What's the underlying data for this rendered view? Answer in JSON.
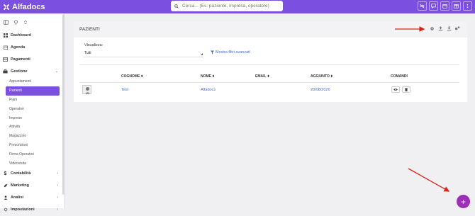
{
  "app": {
    "name": "Alfadocs"
  },
  "search": {
    "placeholder": "Cerca... (Es: paziente, impresa, operatore)"
  },
  "topbar": {
    "icons": [
      "eye-off-icon",
      "chat-icon",
      "calendar-icon",
      "gift-icon",
      "more-vertical-icon"
    ]
  },
  "sidebar": {
    "items": [
      {
        "label": "Dashboard",
        "icon": "grid-icon"
      },
      {
        "label": "Agenda",
        "icon": "calendar-icon"
      },
      {
        "label": "Pagamenti",
        "icon": "card-icon"
      },
      {
        "label": "Gestione",
        "icon": "briefcase-icon",
        "expanded": true
      }
    ],
    "subitems": [
      "Appuntamenti",
      "Pazienti",
      "Piani",
      "Operatori",
      "Imprese",
      "Attività",
      "Magazzino",
      "Prescrizioni",
      "Firma Operatori",
      "Videovisita"
    ],
    "active_sub": "Pazienti",
    "bottom_items": [
      {
        "label": "Contabilità",
        "icon": "dollar-icon"
      },
      {
        "label": "Marketing",
        "icon": "rocket-icon"
      },
      {
        "label": "Analisi",
        "icon": "user-icon"
      },
      {
        "label": "Impostazioni",
        "icon": "gear-icon"
      }
    ]
  },
  "page": {
    "title": "PAZIENTI",
    "visualizza_label": "Visualizza:",
    "visualizza_value": "Tutti",
    "advanced_filters": "Mostra filtri avanzati"
  },
  "table": {
    "columns": [
      "COGNOME",
      "NOME",
      "EMAIL",
      "AGGIUNTO",
      "COMANDI"
    ],
    "rows": [
      {
        "cognome": "Test",
        "nome": "Alfadocs",
        "email": "",
        "aggiunto": "20/08/2026"
      }
    ]
  },
  "colors": {
    "accent": "#7b4fe0",
    "link": "#4a6cc9",
    "fab": "#9b2fb8",
    "annotation": "#d9261c"
  }
}
